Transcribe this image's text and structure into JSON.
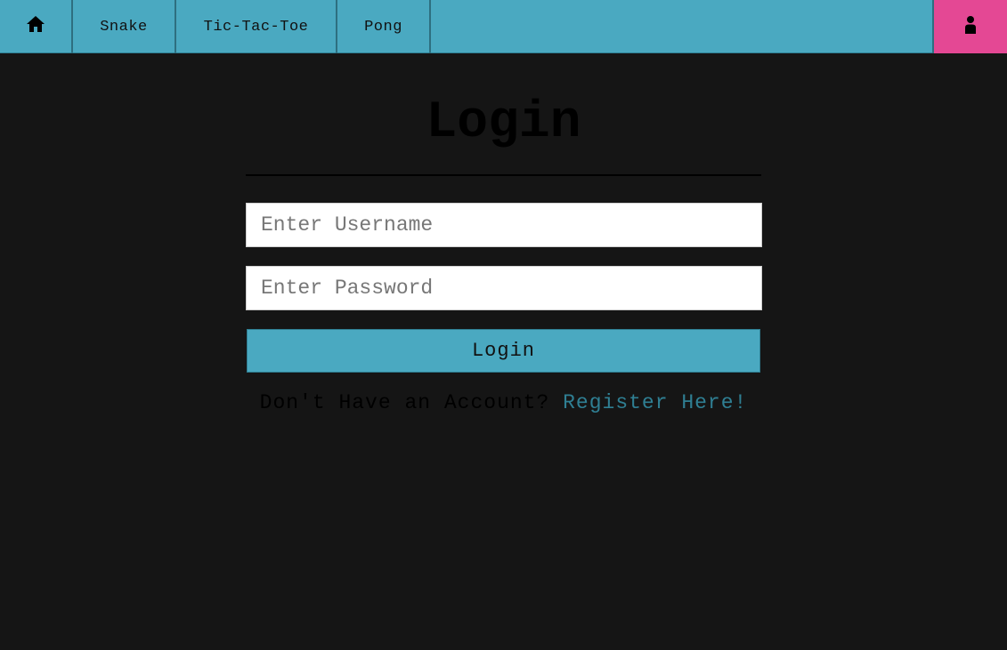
{
  "navbar": {
    "home_icon": "home-icon",
    "items": [
      {
        "label": "Snake"
      },
      {
        "label": "Tic-Tac-Toe"
      },
      {
        "label": "Pong"
      }
    ],
    "user_icon": "user-icon",
    "colors": {
      "bar": "#4aa9c1",
      "user_button": "#e44894"
    }
  },
  "form": {
    "title": "Login",
    "username_placeholder": "Enter Username",
    "password_placeholder": "Enter Password",
    "submit_label": "Login",
    "register_prompt": "Don't Have an Account?",
    "register_link": "Register Here!"
  }
}
